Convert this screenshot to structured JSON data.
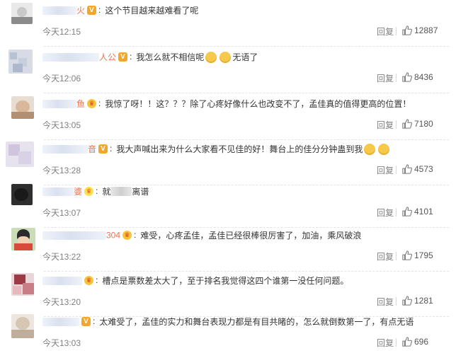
{
  "comments": [
    {
      "username": "火",
      "badge": "v",
      "text": "这个节目越来越难看了呢",
      "time": "今天12:15",
      "reply": "回复",
      "likes": "12887"
    },
    {
      "username": "人公",
      "badge": "v",
      "text": "我怎么就不相信呢",
      "emoji_after": "无语了",
      "time": "今天12:06",
      "reply": "回复",
      "likes": "8436"
    },
    {
      "username": "鱼",
      "badge": "vip",
      "text": "我惊了呀！！这？？？除了心疼好像什么也改变不了，孟佳真的值得更高的位置！",
      "time": "今天13:05",
      "reply": "回复",
      "likes": "7180"
    },
    {
      "username": "音",
      "badge": "v",
      "text": "我大声喊出来为什么大家看不见佳的好！舞台上的佳分分钟蛊到我",
      "time": "今天13:28",
      "reply": "回复",
      "likes": "4573"
    },
    {
      "username": "婆",
      "badge": "crown",
      "text_prefix": "就",
      "text_suffix": "离谱",
      "time": "今天13:07",
      "reply": "回复",
      "likes": "4101"
    },
    {
      "username": "304",
      "badge": "vip",
      "text": "难受，心疼孟佳，孟佳已经很棒很厉害了，加油，乘风破浪",
      "time": "今天13:22",
      "reply": "回复",
      "likes": "1795"
    },
    {
      "username": "",
      "badge": "vip",
      "text": "槽点是票数差太大了，至于排名我觉得这四个谁第一没任何问题。",
      "time": "今天13:20",
      "reply": "回复",
      "likes": "1281"
    },
    {
      "username": "",
      "badge": "v",
      "text": "太难受了，孟佳的实力和舞台表现力都是有目共睹的，怎么就倒数第一了，有点无语",
      "time": "今天13:03",
      "reply": "回复",
      "likes": "696"
    }
  ],
  "colors": {
    "link": "#808080",
    "text": "#333333",
    "badge_v": "#f3a628"
  },
  "icons": {
    "like": "thumbs-up-icon",
    "emoji": "smiley-emoji-icon"
  }
}
